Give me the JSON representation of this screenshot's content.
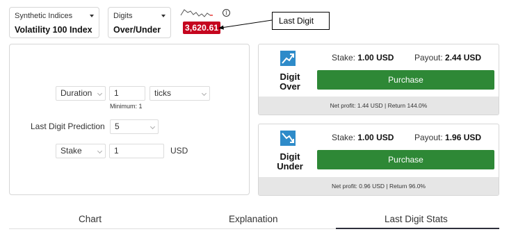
{
  "header": {
    "market": {
      "label": "Synthetic Indices",
      "value": "Volatility 100 Index"
    },
    "trade_type": {
      "label": "Digits",
      "value": "Over/Under"
    },
    "price": "3,620.61",
    "annotation": "Last Digit"
  },
  "params": {
    "duration": {
      "label": "Duration",
      "value": "1",
      "unit": "ticks",
      "hint": "Minimum: 1"
    },
    "prediction": {
      "label": "Last Digit Prediction",
      "value": "5"
    },
    "stake": {
      "label": "Stake",
      "value": "1",
      "currency": "USD"
    }
  },
  "contracts": [
    {
      "title_line1": "Digit",
      "title_line2": "Over",
      "stake_label": "Stake:",
      "stake_value": "1.00 USD",
      "payout_label": "Payout:",
      "payout_value": "2.44 USD",
      "button": "Purchase",
      "footer": "Net profit: 1.44 USD | Return 144.0%"
    },
    {
      "title_line1": "Digit",
      "title_line2": "Under",
      "stake_label": "Stake:",
      "stake_value": "1.00 USD",
      "payout_label": "Payout:",
      "payout_value": "1.96 USD",
      "button": "Purchase",
      "footer": "Net profit: 0.96 USD | Return 96.0%"
    }
  ],
  "tabs": [
    "Chart",
    "Explanation",
    "Last Digit Stats"
  ],
  "active_tab": "Last Digit Stats",
  "colors": {
    "price_badge": "#c5051f",
    "purchase": "#2e8836",
    "contract_icon": "#2e8bc9"
  }
}
